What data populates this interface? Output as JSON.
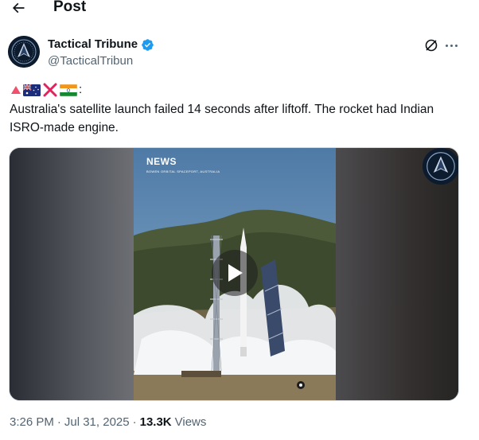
{
  "header": {
    "title": "Post"
  },
  "author": {
    "display_name": "Tactical Tribune",
    "handle": "@TacticalTribun",
    "verified_color": "#1d9bf0"
  },
  "tweet": {
    "emoji_suffix": ":",
    "text": "Australia's satellite launch failed 14 seconds after liftoff. The rocket had Indian ISRO-made engine."
  },
  "media": {
    "type": "video",
    "overlay_label": "NEWS",
    "overlay_sub": "BOWEN ORBITAL SPACEPORT, AUSTRALIA"
  },
  "meta": {
    "time": "3:26 PM",
    "separator": "·",
    "date": "Jul 31, 2025",
    "views_count": "13.3K",
    "views_label": "Views"
  },
  "icons": {
    "back": "arrow-left-icon",
    "verified": "verified-badge-icon",
    "grok": "grok-icon",
    "more": "more-horizontal-icon",
    "play": "play-icon"
  }
}
